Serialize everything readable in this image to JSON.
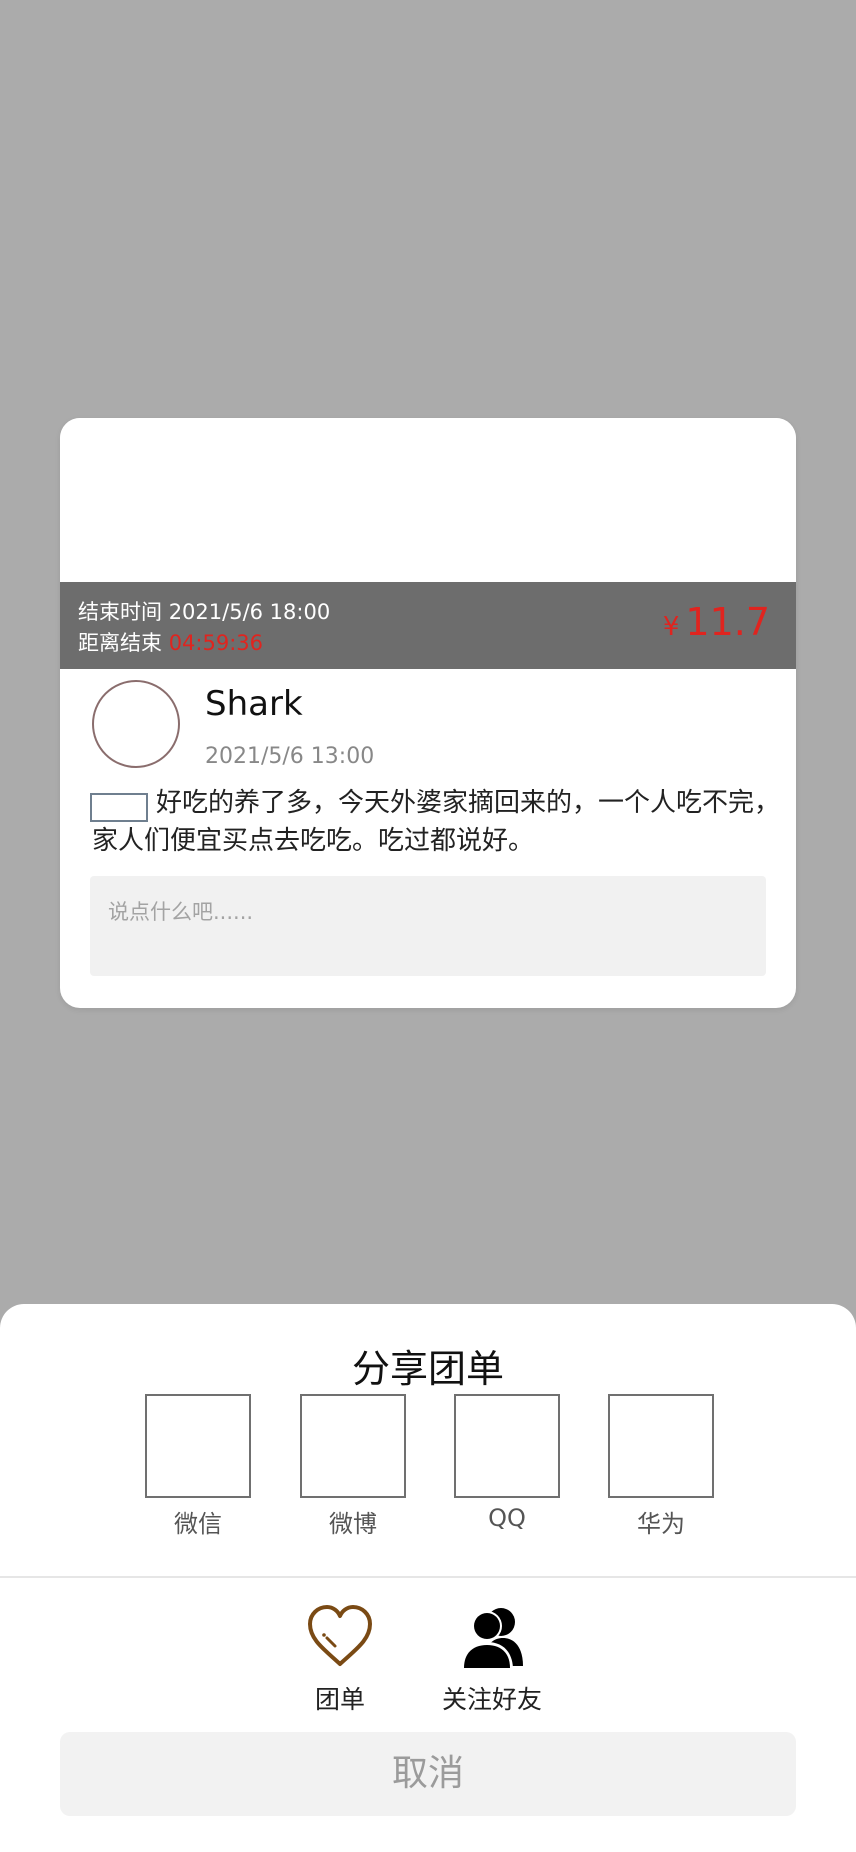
{
  "post": {
    "end_time_label": "结束时间",
    "end_time_value": "2021/5/6  18:00",
    "remaining_label": "距离结束",
    "remaining_value": "04:59:36",
    "price_symbol": "¥",
    "price_value": "11.7",
    "username": "Shark",
    "post_time": "2021/5/6  13:00",
    "content": "好吃的养了多，今天外婆家摘回来的，一个人吃不完，家人们便宜买点去吃吃。吃过都说好。",
    "comment_placeholder": "说点什么吧......"
  },
  "share_sheet": {
    "title": "分享团单",
    "targets": [
      {
        "label": "微信"
      },
      {
        "label": "微博"
      },
      {
        "label": "QQ"
      },
      {
        "label": "华为"
      }
    ],
    "actions": [
      {
        "label": "团单",
        "icon": "heart-icon"
      },
      {
        "label": "关注好友",
        "icon": "users-icon"
      }
    ],
    "cancel_label": "取消"
  },
  "colors": {
    "overlay": "#ababab",
    "price": "#e0241f",
    "info_bar": "#6d6d6d",
    "heart": "#7a4a14"
  }
}
